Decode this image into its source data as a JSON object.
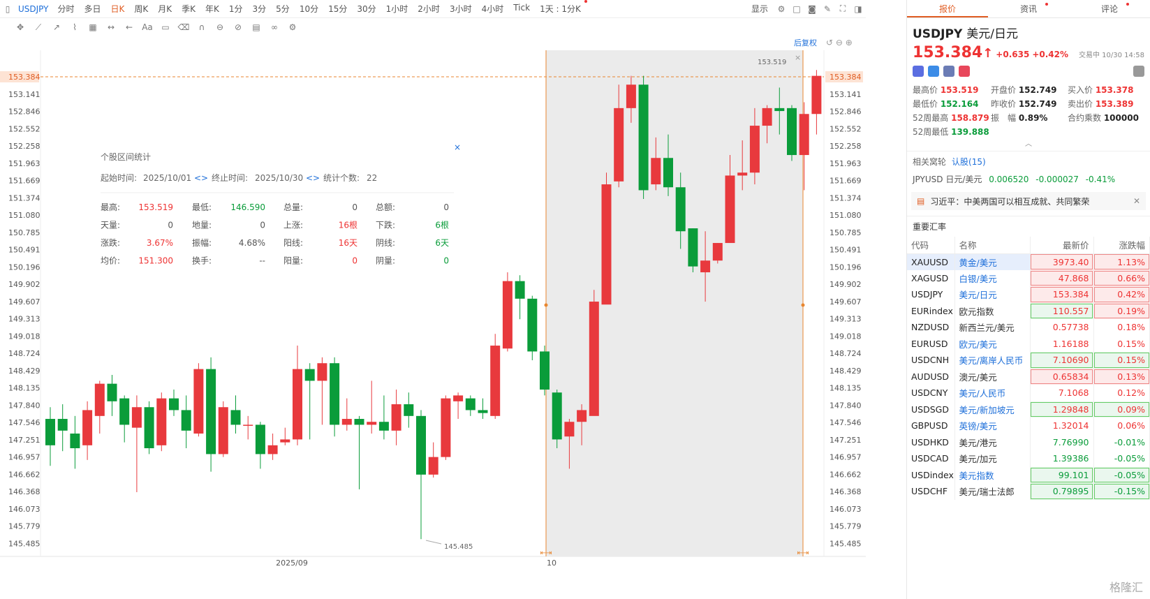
{
  "topbar": {
    "symbol": "USDJPY",
    "periods": [
      "分时",
      "多日",
      "日K",
      "周K",
      "月K",
      "季K",
      "年K",
      "1分",
      "3分",
      "5分",
      "10分",
      "15分",
      "30分",
      "1小时",
      "2小时",
      "3小时",
      "4小时",
      "Tick",
      "1天 : 1分K"
    ],
    "active_period": "日K",
    "display_label": "显示"
  },
  "chart": {
    "current_price_label": "153.384",
    "hi_marker": "153.519",
    "lo_marker": "145.485",
    "restore_label": "后复权",
    "y_ticks": [
      "153.384",
      "153.141",
      "152.846",
      "152.552",
      "152.258",
      "151.963",
      "151.669",
      "151.374",
      "151.080",
      "150.785",
      "150.491",
      "150.196",
      "149.902",
      "149.607",
      "149.313",
      "149.018",
      "148.724",
      "148.429",
      "148.135",
      "147.840",
      "147.546",
      "147.251",
      "146.957",
      "146.662",
      "146.368",
      "146.073",
      "145.779",
      "145.485"
    ],
    "x_labels": [
      "2025/09",
      "10"
    ],
    "colors": {
      "up": "#e8393d",
      "down": "#0a9c3a",
      "shade": "#ebebeb",
      "marker": "#e8862f"
    }
  },
  "chart_data": {
    "type": "candlestick",
    "ylim": [
      145.3,
      154.0
    ],
    "candles": [
      [
        147.55,
        147.1,
        147.75,
        146.75
      ],
      [
        147.55,
        147.35,
        147.8,
        147.0
      ],
      [
        147.3,
        147.05,
        147.6,
        146.7
      ],
      [
        147.1,
        147.7,
        147.85,
        146.85
      ],
      [
        147.6,
        148.15,
        148.2,
        147.3
      ],
      [
        148.15,
        147.85,
        148.3,
        147.6
      ],
      [
        147.9,
        147.45,
        147.95,
        147.15
      ],
      [
        147.4,
        147.75,
        147.95,
        146.3
      ],
      [
        147.75,
        147.05,
        147.85,
        146.95
      ],
      [
        147.1,
        147.9,
        148.0,
        147.0
      ],
      [
        147.9,
        147.7,
        148.05,
        147.6
      ],
      [
        147.7,
        147.35,
        147.95,
        147.05
      ],
      [
        147.3,
        148.4,
        148.5,
        147.25
      ],
      [
        148.4,
        146.95,
        148.6,
        146.65
      ],
      [
        146.95,
        147.75,
        147.85,
        146.9
      ],
      [
        147.7,
        147.45,
        147.95,
        147.3
      ],
      [
        147.45,
        147.45,
        147.6,
        147.2
      ],
      [
        147.45,
        146.95,
        147.5,
        146.7
      ],
      [
        146.95,
        147.1,
        147.3,
        146.85
      ],
      [
        147.15,
        147.2,
        147.4,
        147.1
      ],
      [
        147.2,
        148.4,
        148.8,
        147.1
      ],
      [
        148.4,
        148.2,
        148.5,
        147.2
      ],
      [
        148.2,
        148.5,
        148.6,
        147.45
      ],
      [
        148.5,
        147.45,
        148.6,
        147.25
      ],
      [
        147.45,
        147.55,
        147.9,
        147.35
      ],
      [
        147.55,
        147.45,
        147.6,
        146.35
      ],
      [
        147.45,
        147.5,
        148.2,
        147.3
      ],
      [
        147.5,
        147.35,
        147.95,
        147.2
      ],
      [
        147.35,
        147.8,
        148.05,
        147.1
      ],
      [
        147.8,
        147.6,
        148.0,
        147.4
      ],
      [
        147.6,
        146.6,
        147.7,
        145.5
      ],
      [
        146.6,
        146.9,
        147.15,
        146.55
      ],
      [
        146.9,
        147.9,
        147.95,
        146.85
      ],
      [
        147.85,
        147.95,
        148.0,
        147.55
      ],
      [
        147.9,
        147.7,
        147.95,
        147.6
      ],
      [
        147.7,
        147.65,
        147.9,
        147.55
      ],
      [
        147.6,
        148.8,
        149.0,
        147.55
      ],
      [
        148.75,
        149.9,
        150.05,
        148.7
      ],
      [
        149.9,
        149.6,
        150.0,
        149.25
      ],
      [
        149.6,
        148.7,
        149.65,
        148.55
      ],
      [
        148.7,
        148.05,
        148.8,
        147.95
      ],
      [
        148.0,
        147.2,
        148.05,
        147.05
      ],
      [
        147.25,
        147.5,
        147.55,
        146.7
      ],
      [
        147.5,
        147.7,
        147.8,
        147.1
      ],
      [
        147.6,
        149.55,
        149.75,
        148.95
      ],
      [
        149.5,
        151.55,
        151.75,
        149.55
      ],
      [
        151.6,
        152.85,
        153.25,
        151.5
      ],
      [
        152.85,
        153.25,
        153.4,
        152.6
      ],
      [
        153.25,
        151.45,
        153.4,
        151.3
      ],
      [
        151.55,
        152.0,
        152.35,
        151.45
      ],
      [
        152.0,
        151.5,
        152.4,
        151.35
      ],
      [
        151.5,
        150.75,
        151.75,
        150.45
      ],
      [
        150.8,
        150.15,
        150.8,
        150.05
      ],
      [
        150.05,
        150.25,
        150.75,
        149.55
      ],
      [
        150.25,
        150.55,
        150.55,
        150.2
      ],
      [
        150.55,
        151.7,
        152.05,
        150.55
      ],
      [
        151.7,
        151.75,
        152.3,
        151.45
      ],
      [
        151.75,
        152.55,
        152.85,
        151.55
      ],
      [
        152.55,
        152.85,
        152.9,
        152.25
      ],
      [
        152.85,
        152.8,
        153.2,
        152.4
      ],
      [
        152.85,
        152.05,
        152.9,
        151.95
      ],
      [
        152.05,
        152.75,
        152.95,
        151.45
      ],
      [
        152.75,
        153.4,
        153.5,
        152.4
      ]
    ],
    "selection": {
      "start": "2025/10/01",
      "end": "2025/10/30"
    }
  },
  "popup": {
    "title": "个股区间统计",
    "start_label": "起始时间:",
    "start_date": "2025/10/01",
    "end_label": "终止时间:",
    "end_date": "2025/10/30",
    "count_label": "统计个数:",
    "count": "22",
    "rows": [
      [
        "最高:",
        "153.519",
        "最低:",
        "146.590",
        "总量:",
        "0",
        "总额:",
        "0"
      ],
      [
        "天量:",
        "0",
        "地量:",
        "0",
        "上涨:",
        "16根",
        "下跌:",
        "6根"
      ],
      [
        "涨跌:",
        "3.67%",
        "振幅:",
        "4.68%",
        "阳线:",
        "16天",
        "阴线:",
        "6天"
      ],
      [
        "均价:",
        "151.300",
        "换手:",
        "--",
        "阳量:",
        "0",
        "阴量:",
        "0"
      ]
    ]
  },
  "quote": {
    "tabs": [
      "报价",
      "资讯",
      "评论"
    ],
    "code": "USDJPY",
    "name": "美元/日元",
    "price": "153.384",
    "arrow": "↑",
    "change": "+0.635",
    "pct": "+0.42%",
    "time": "交易中 10/30 14:58",
    "stats": [
      [
        "最高价",
        "153.519",
        "开盘价",
        "152.749",
        "买入价",
        "153.378"
      ],
      [
        "最低价",
        "152.164",
        "昨收价",
        "152.749",
        "卖出价",
        "153.389"
      ],
      [
        "52周最高",
        "158.879",
        "振　幅",
        "0.89%",
        "合约乘数",
        "100000"
      ],
      [
        "52周最低",
        "139.888",
        "",
        "",
        "",
        ""
      ]
    ],
    "related_label": "相关窝轮",
    "related_link": "认股(15)",
    "fx_line": {
      "code": "JPYUSD",
      "name": "日元/美元",
      "value": "0.006520",
      "chg": "-0.000027",
      "pct": "-0.41%"
    },
    "news": "习近平：中美两国可以相互成就、共同繁荣",
    "section": "重要汇率",
    "table_headers": [
      "代码",
      "名称",
      "最新价",
      "涨跌幅"
    ],
    "rates": [
      [
        "XAUUSD",
        "黄金/美元",
        "3973.40",
        "1.13%"
      ],
      [
        "XAGUSD",
        "白银/美元",
        "47.868",
        "0.66%"
      ],
      [
        "USDJPY",
        "美元/日元",
        "153.384",
        "0.42%"
      ],
      [
        "EURindex",
        "欧元指数",
        "110.557",
        "0.19%"
      ],
      [
        "NZDUSD",
        "新西兰元/美元",
        "0.57738",
        "0.18%"
      ],
      [
        "EURUSD",
        "欧元/美元",
        "1.16188",
        "0.15%"
      ],
      [
        "USDCNH",
        "美元/离岸人民币",
        "7.10690",
        "0.15%"
      ],
      [
        "AUDUSD",
        "澳元/美元",
        "0.65834",
        "0.13%"
      ],
      [
        "USDCNY",
        "美元/人民币",
        "7.1068",
        "0.12%"
      ],
      [
        "USDSGD",
        "美元/新加坡元",
        "1.29848",
        "0.09%"
      ],
      [
        "GBPUSD",
        "英镑/美元",
        "1.32014",
        "0.06%"
      ],
      [
        "USDHKD",
        "美元/港元",
        "7.76990",
        "-0.01%"
      ],
      [
        "USDCAD",
        "美元/加元",
        "1.39386",
        "-0.05%"
      ],
      [
        "USDindex",
        "美元指数",
        "99.101",
        "-0.05%"
      ],
      [
        "USDCHF",
        "美元/瑞士法郎",
        "0.79895",
        "-0.15%"
      ]
    ],
    "logo": "格隆汇"
  }
}
